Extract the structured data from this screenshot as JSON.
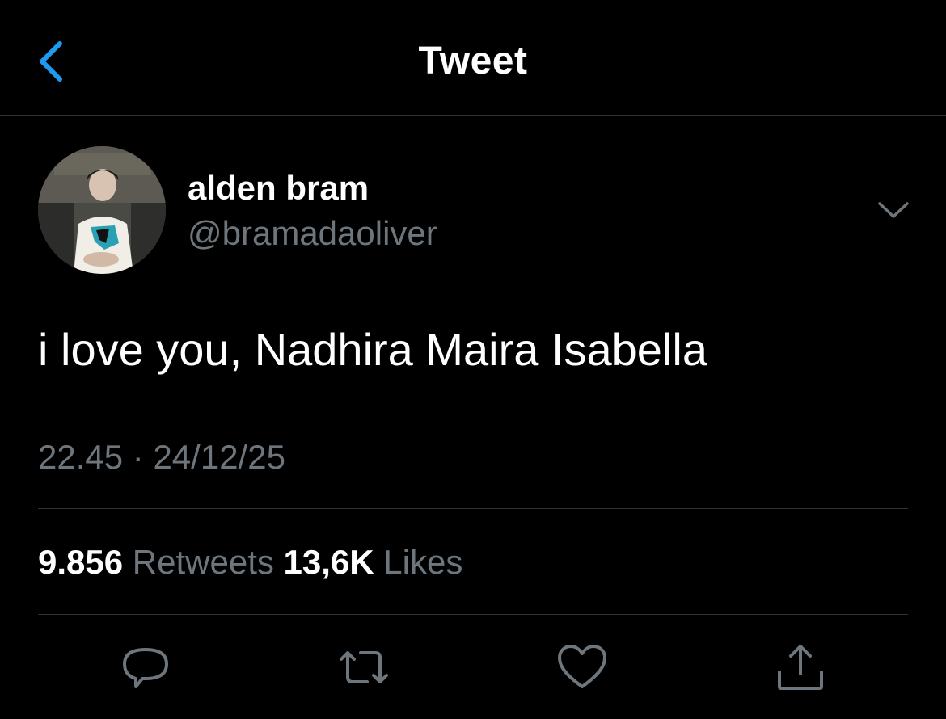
{
  "header": {
    "title": "Tweet",
    "back_icon": "chevron-left-icon",
    "accent_color": "#1d9bf0"
  },
  "tweet": {
    "author_name": "alden bram",
    "author_handle": "@bramadaoliver",
    "text": "i love you, Nadhira Maira Isabella",
    "time": "22.45",
    "separator": "·",
    "date": "24/12/25",
    "more_icon": "chevron-down-icon"
  },
  "stats": {
    "retweets_count": "9.856",
    "retweets_label": "Retweets",
    "likes_count": "13,6K",
    "likes_label": "Likes"
  },
  "actions": [
    {
      "icon": "reply-icon"
    },
    {
      "icon": "retweet-icon"
    },
    {
      "icon": "like-icon"
    },
    {
      "icon": "share-icon"
    }
  ],
  "colors": {
    "background": "#000000",
    "text_primary": "#ffffff",
    "text_secondary": "#6e767d",
    "divider": "#2f3336"
  }
}
